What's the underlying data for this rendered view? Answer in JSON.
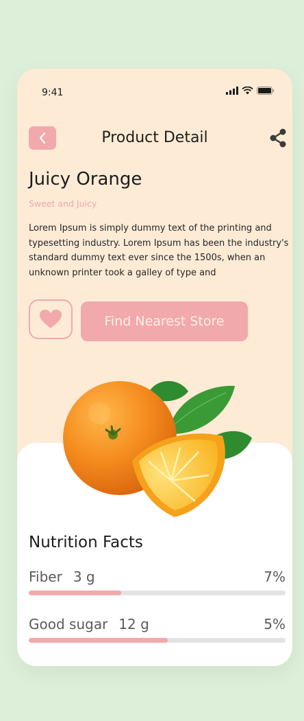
{
  "status_bar": {
    "time": "9:41"
  },
  "header": {
    "title": "Product Detail",
    "back_icon": "chevron-left-icon",
    "share_icon": "share-icon"
  },
  "product": {
    "name": "Juicy Orange",
    "tagline": "Sweet and Juicy",
    "description": "Lorem Ipsum is simply dummy text of the printing and typesetting industry. Lorem Ipsum has been the industry's standard dummy text ever since the 1500s, when an unknown printer took a galley of type and"
  },
  "actions": {
    "favorite_icon": "heart-icon",
    "find_store_label": "Find Nearest Store"
  },
  "nutrition": {
    "title": "Nutrition Facts",
    "items": [
      {
        "name": "Fiber",
        "amount": "3 g",
        "percent": "7%",
        "level": 0.36
      },
      {
        "name": "Good sugar",
        "amount": "12 g",
        "percent": "5%",
        "level": 0.54
      }
    ]
  },
  "colors": {
    "background": "#ddefd9",
    "card_top": "#fdebd6",
    "accent": "#f1a9ab",
    "track": "#e3e3e3"
  }
}
